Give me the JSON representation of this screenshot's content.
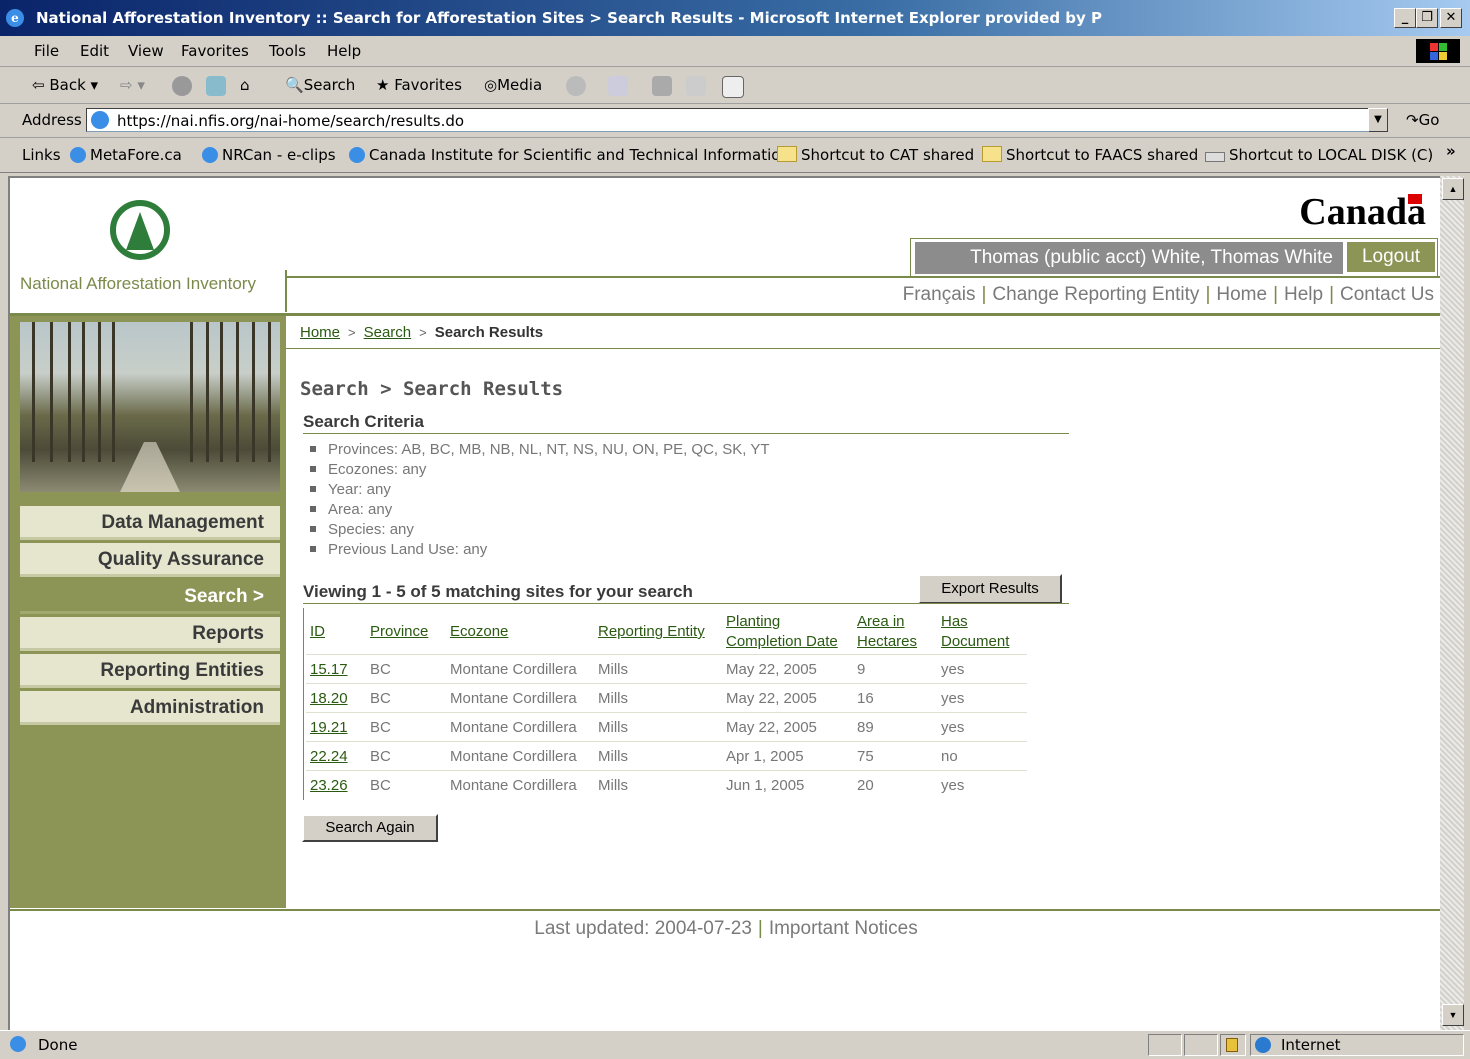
{
  "window": {
    "title": "National Afforestation Inventory :: Search for Afforestation Sites > Search Results - Microsoft Internet Explorer provided by P"
  },
  "menu": [
    "File",
    "Edit",
    "View",
    "Favorites",
    "Tools",
    "Help"
  ],
  "toolbar": {
    "back": "Back",
    "search": "Search",
    "favorites": "Favorites",
    "media": "Media"
  },
  "address": {
    "label": "Address",
    "url": "https://nai.nfis.org/nai-home/search/results.do",
    "go": "Go"
  },
  "links": {
    "label": "Links",
    "items": [
      "MetaFore.ca",
      "NRCan - e-clips",
      "Canada Institute for Scientific and Technical Information",
      "Shortcut to CAT shared",
      "Shortcut to FAACS shared",
      "Shortcut to LOCAL DISK (C)"
    ]
  },
  "site": {
    "logo_text": "National Afforestation Inventory",
    "wordmark": "Canada",
    "user": "Thomas (public acct) White, Thomas White",
    "logout": "Logout",
    "top_links": [
      "Français",
      "Change Reporting Entity",
      "Home",
      "Help",
      "Contact Us"
    ]
  },
  "nav": {
    "items": [
      "Data Management",
      "Quality Assurance",
      "Search >",
      "Reports",
      "Reporting Entities",
      "Administration"
    ],
    "active_index": 2
  },
  "breadcrumb": {
    "home": "Home",
    "search": "Search",
    "current": "Search Results",
    "sep": ">"
  },
  "content": {
    "heading": "Search > Search Results",
    "criteria_heading": "Search Criteria",
    "criteria": [
      "Provinces: AB, BC, MB, NB, NL, NT, NS, NU, ON, PE, QC, SK, YT",
      "Ecozones: any",
      "Year: any",
      "Area: any",
      "Species: any",
      "Previous Land Use: any"
    ],
    "viewing": "Viewing 1 - 5 of 5 matching sites for your search",
    "export_button": "Export Results",
    "search_again_button": "Search Again",
    "table": {
      "headers": [
        "ID",
        "Province",
        "Ecozone",
        "Reporting Entity",
        "Planting Completion Date",
        "Area in Hectares",
        "Has Document"
      ],
      "rows": [
        [
          "15.17",
          "BC",
          "Montane Cordillera",
          "Mills",
          "May 22, 2005",
          "9",
          "yes"
        ],
        [
          "18.20",
          "BC",
          "Montane Cordillera",
          "Mills",
          "May 22, 2005",
          "16",
          "yes"
        ],
        [
          "19.21",
          "BC",
          "Montane Cordillera",
          "Mills",
          "May 22, 2005",
          "89",
          "yes"
        ],
        [
          "22.24",
          "BC",
          "Montane Cordillera",
          "Mills",
          "Apr 1, 2005",
          "75",
          "no"
        ],
        [
          "23.26",
          "BC",
          "Montane Cordillera",
          "Mills",
          "Jun 1, 2005",
          "20",
          "yes"
        ]
      ]
    }
  },
  "footer": {
    "last_updated": "Last updated: 2004-07-23",
    "notices": "Important Notices"
  },
  "status": {
    "text": "Done",
    "zone": "Internet"
  },
  "colors": {
    "accent_green": "#8c9456",
    "link_green": "#2a5a12",
    "nav_bg": "#e6e6cf"
  }
}
